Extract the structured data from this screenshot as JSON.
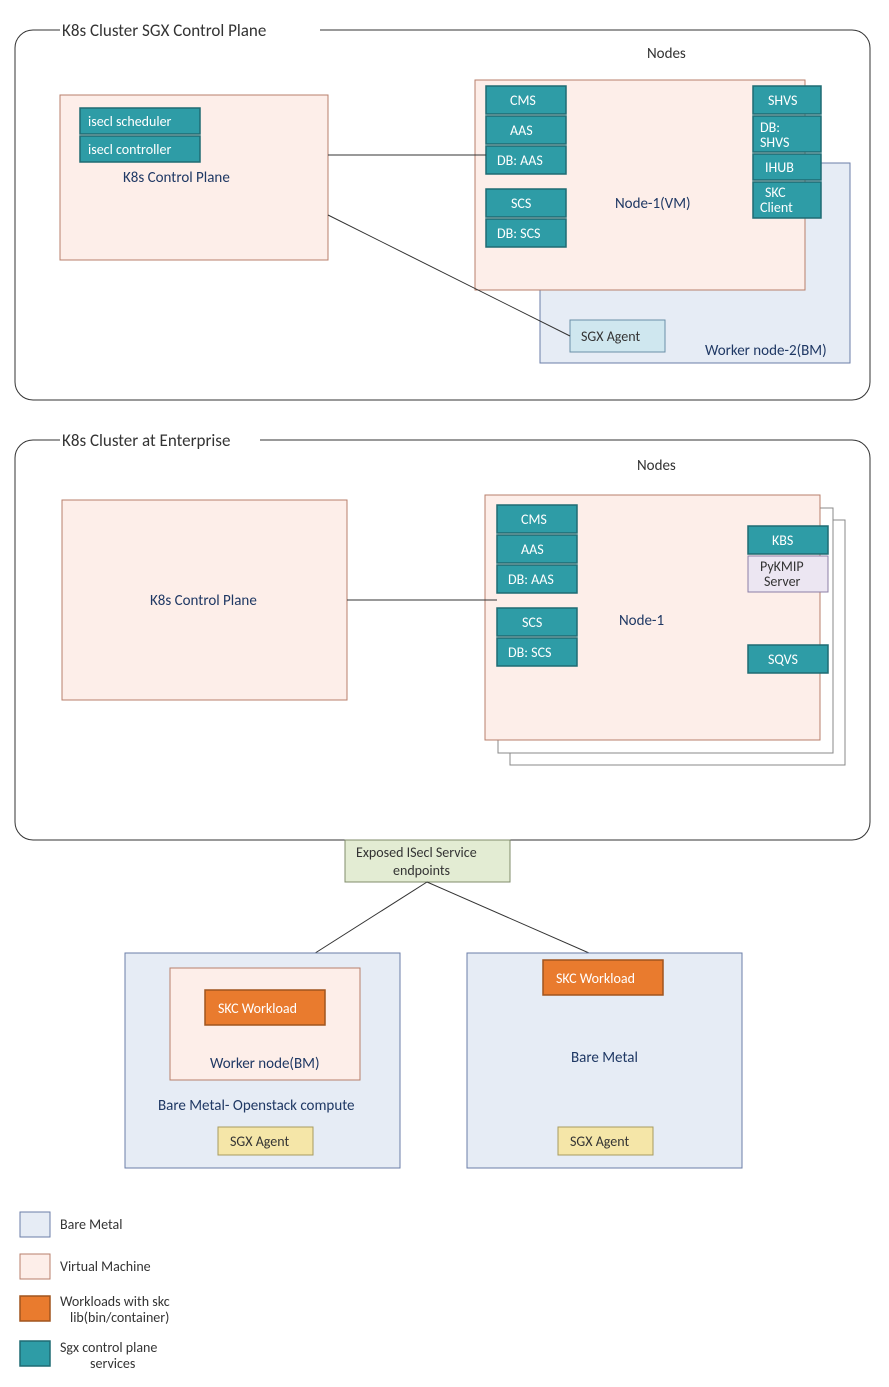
{
  "cluster1": {
    "title": "K8s Cluster SGX Control Plane",
    "nodes_label": "Nodes",
    "cp_label": "K8s Control Plane",
    "cp_boxes": {
      "scheduler": "isecl scheduler",
      "controller": "isecl controller"
    },
    "node1_label": "Node-1(VM)",
    "node2_label": "Worker node-2(BM)",
    "sgx_agent": "SGX Agent",
    "left_services": [
      "CMS",
      "AAS",
      "DB: AAS",
      "SCS",
      "DB: SCS"
    ],
    "right_services": [
      "SHVS",
      "DB: SHVS",
      "IHUB",
      "SKC Client"
    ]
  },
  "cluster2": {
    "title": "K8s Cluster at Enterprise",
    "nodes_label": "Nodes",
    "cp_label": "K8s Control Plane",
    "node1_label": "Node-1",
    "left_services": [
      "CMS",
      "AAS",
      "DB: AAS",
      "SCS",
      "DB: SCS"
    ],
    "right": {
      "kbs": "KBS",
      "pykmip1": "PyKMIP",
      "pykmip2": "Server",
      "sqvs": "SQVS"
    }
  },
  "endpoints": {
    "line1": "Exposed ISecl Service",
    "line2": "endpoints"
  },
  "left_host": {
    "skc": "SKC Workload",
    "wn": "Worker node(BM)",
    "sub": "Bare Metal- Openstack compute",
    "agent": "SGX Agent"
  },
  "right_host": {
    "skc": "SKC Workload",
    "sub": "Bare Metal",
    "agent": "SGX Agent"
  },
  "legend": {
    "bm": "Bare Metal",
    "vm": "Virtual Machine",
    "wl1": "Workloads with skc",
    "wl2": "lib(bin/container)",
    "svc1": "Sgx control plane",
    "svc2": "services"
  }
}
